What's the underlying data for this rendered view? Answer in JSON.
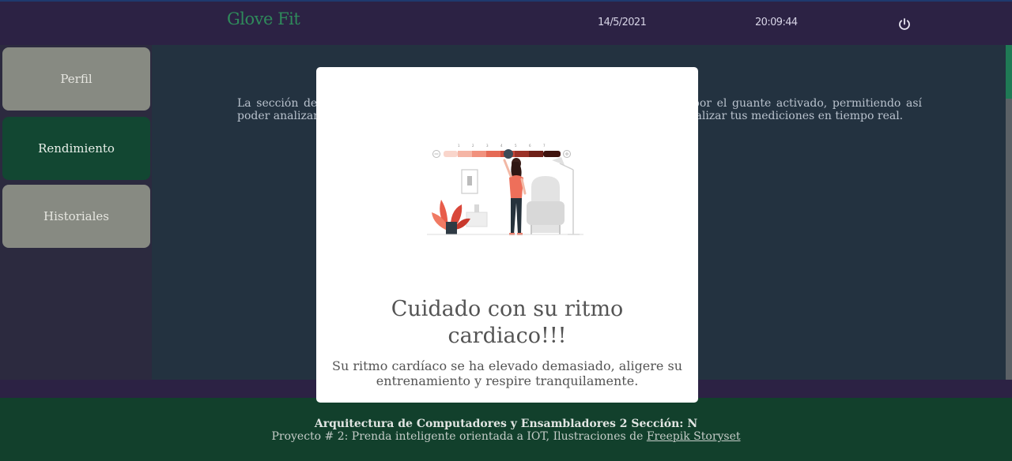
{
  "header": {
    "brand": "Glove Fit",
    "date": "14/5/2021",
    "time": "20:09:44",
    "power_icon": "power-icon"
  },
  "sidebar": {
    "items": [
      {
        "label": "Perfil",
        "active": false
      },
      {
        "label": "Rendimiento",
        "active": true
      },
      {
        "label": "Historiales",
        "active": false
      }
    ]
  },
  "main": {
    "intro": "La sección de rendimiento muestra las mediciones y el seguimiento obtenido por el guante activado, permitiendo así poder analizar su rendimiento. Puede seleccionar una evaluación para poder visualizar tus mediciones en tiempo real."
  },
  "modal": {
    "title": "Cuidado con su ritmo cardiaco!!!",
    "text": "Su ritmo cardíaco se ha elevado demasiado, aligere su entrenamiento y respire tranquilamente.",
    "illustration": "thermostat-woman-illustration"
  },
  "footer": {
    "line1": "Arquitectura de Computadores y Ensambladores 2 Sección: N",
    "line2_prefix": "Proyecto # 2: Prenda inteligente orientada a IOT, Ilustraciones de ",
    "link": "Freepik Storyset"
  },
  "colors": {
    "brand": "#2f8a5b",
    "active_nav": "#124732",
    "inactive_nav": "#878a82",
    "footer_bg": "#12402c",
    "header_bg": "#2c2244",
    "main_bg": "#233240"
  }
}
